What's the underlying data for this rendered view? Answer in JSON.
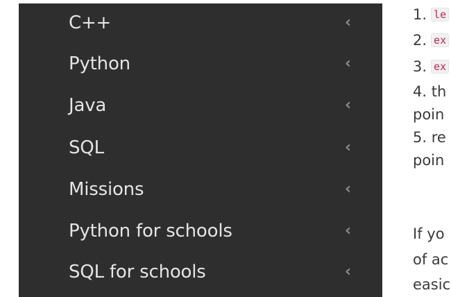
{
  "sidebar": {
    "items": [
      {
        "label": "C++"
      },
      {
        "label": "Python"
      },
      {
        "label": "Java"
      },
      {
        "label": "SQL"
      },
      {
        "label": "Missions"
      },
      {
        "label": "Python for schools"
      },
      {
        "label": "SQL for schools"
      }
    ],
    "chevron": "‹"
  },
  "content": {
    "line1_num": "1.",
    "line1_code": "le",
    "line2_num": "2.",
    "line2_code": "ex",
    "line3_num": "3.",
    "line3_code": "ex",
    "line4": "4. th",
    "line5": "poin",
    "line6": "5. re",
    "line7": "poin",
    "line8": "If yo",
    "line9": "of ac",
    "line10": "easic"
  }
}
